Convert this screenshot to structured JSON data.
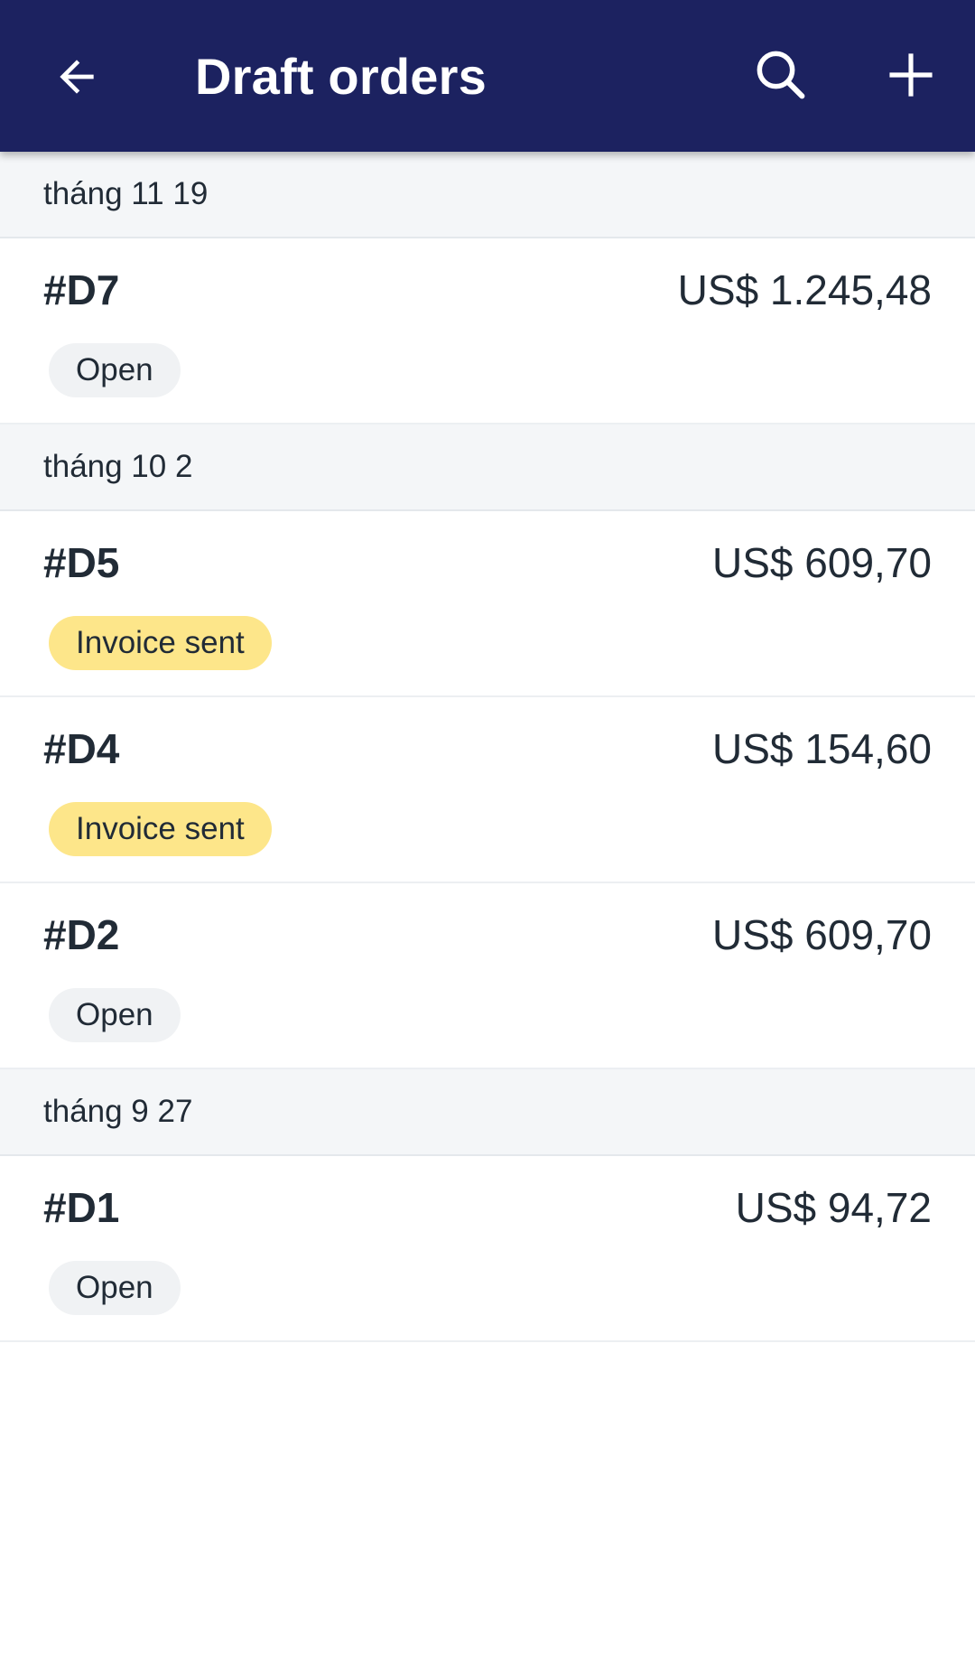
{
  "app_bar": {
    "title": "Draft orders",
    "background": "#1c2260",
    "icons": {
      "back": "arrow-left-icon",
      "search": "search-icon",
      "add": "plus-icon"
    }
  },
  "colors": {
    "section_bg": "#f4f6f8",
    "badge_open_bg": "#f0f2f4",
    "badge_invoice_bg": "#fde68a",
    "text": "#212b36"
  },
  "sections": [
    {
      "date": "tháng 11 19",
      "orders": [
        {
          "id": "#D7",
          "total": "US$ 1.245,48",
          "status": "Open",
          "status_type": "open"
        }
      ]
    },
    {
      "date": "tháng 10 2",
      "orders": [
        {
          "id": "#D5",
          "total": "US$ 609,70",
          "status": "Invoice sent",
          "status_type": "invoice"
        },
        {
          "id": "#D4",
          "total": "US$ 154,60",
          "status": "Invoice sent",
          "status_type": "invoice"
        },
        {
          "id": "#D2",
          "total": "US$ 609,70",
          "status": "Open",
          "status_type": "open"
        }
      ]
    },
    {
      "date": "tháng 9 27",
      "orders": [
        {
          "id": "#D1",
          "total": "US$ 94,72",
          "status": "Open",
          "status_type": "open"
        }
      ]
    }
  ]
}
